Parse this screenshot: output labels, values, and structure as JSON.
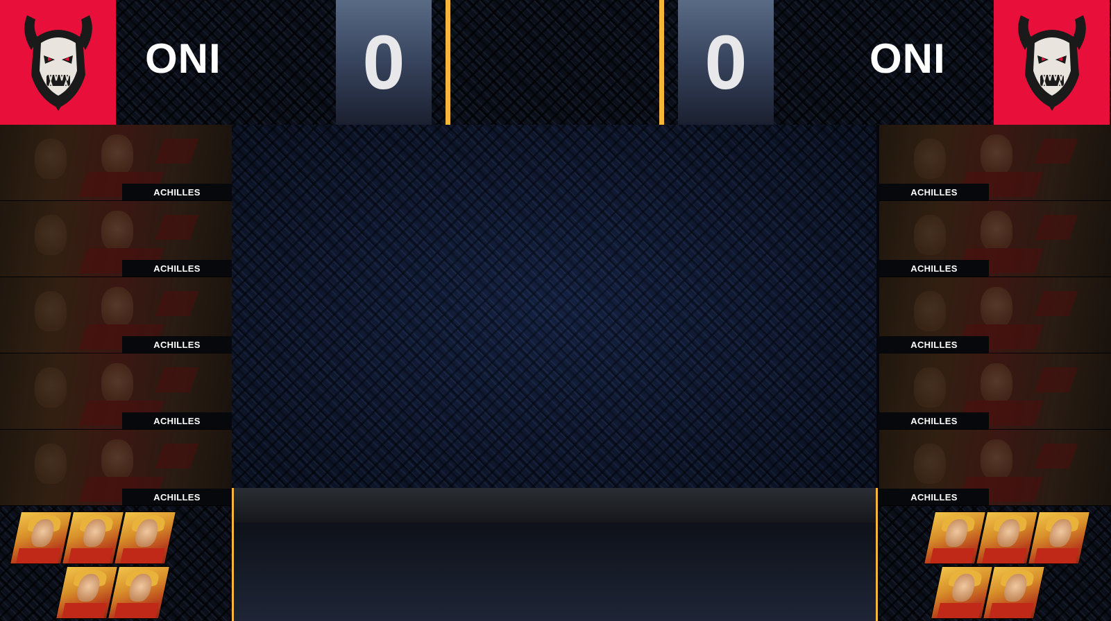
{
  "left_team": {
    "name": "ONI",
    "score": "0",
    "color": "#e8103a",
    "logo_icon": "oni-mask-icon",
    "picks": [
      "ACHILLES",
      "ACHILLES",
      "ACHILLES",
      "ACHILLES",
      "ACHILLES"
    ],
    "bans": [
      "achilles-portrait-icon",
      "achilles-portrait-icon",
      "achilles-portrait-icon",
      "achilles-portrait-icon",
      "achilles-portrait-icon"
    ]
  },
  "right_team": {
    "name": "ONI",
    "score": "0",
    "color": "#e8103a",
    "logo_icon": "oni-mask-icon",
    "picks": [
      "ACHILLES",
      "ACHILLES",
      "ACHILLES",
      "ACHILLES",
      "ACHILLES"
    ],
    "bans": [
      "achilles-portrait-icon",
      "achilles-portrait-icon",
      "achilles-portrait-icon",
      "achilles-portrait-icon",
      "achilles-portrait-icon"
    ]
  },
  "colors": {
    "accent_gold": "#f4b63b",
    "panel_navy": "#101a33",
    "score_gradient_top": "#5a6b85"
  }
}
